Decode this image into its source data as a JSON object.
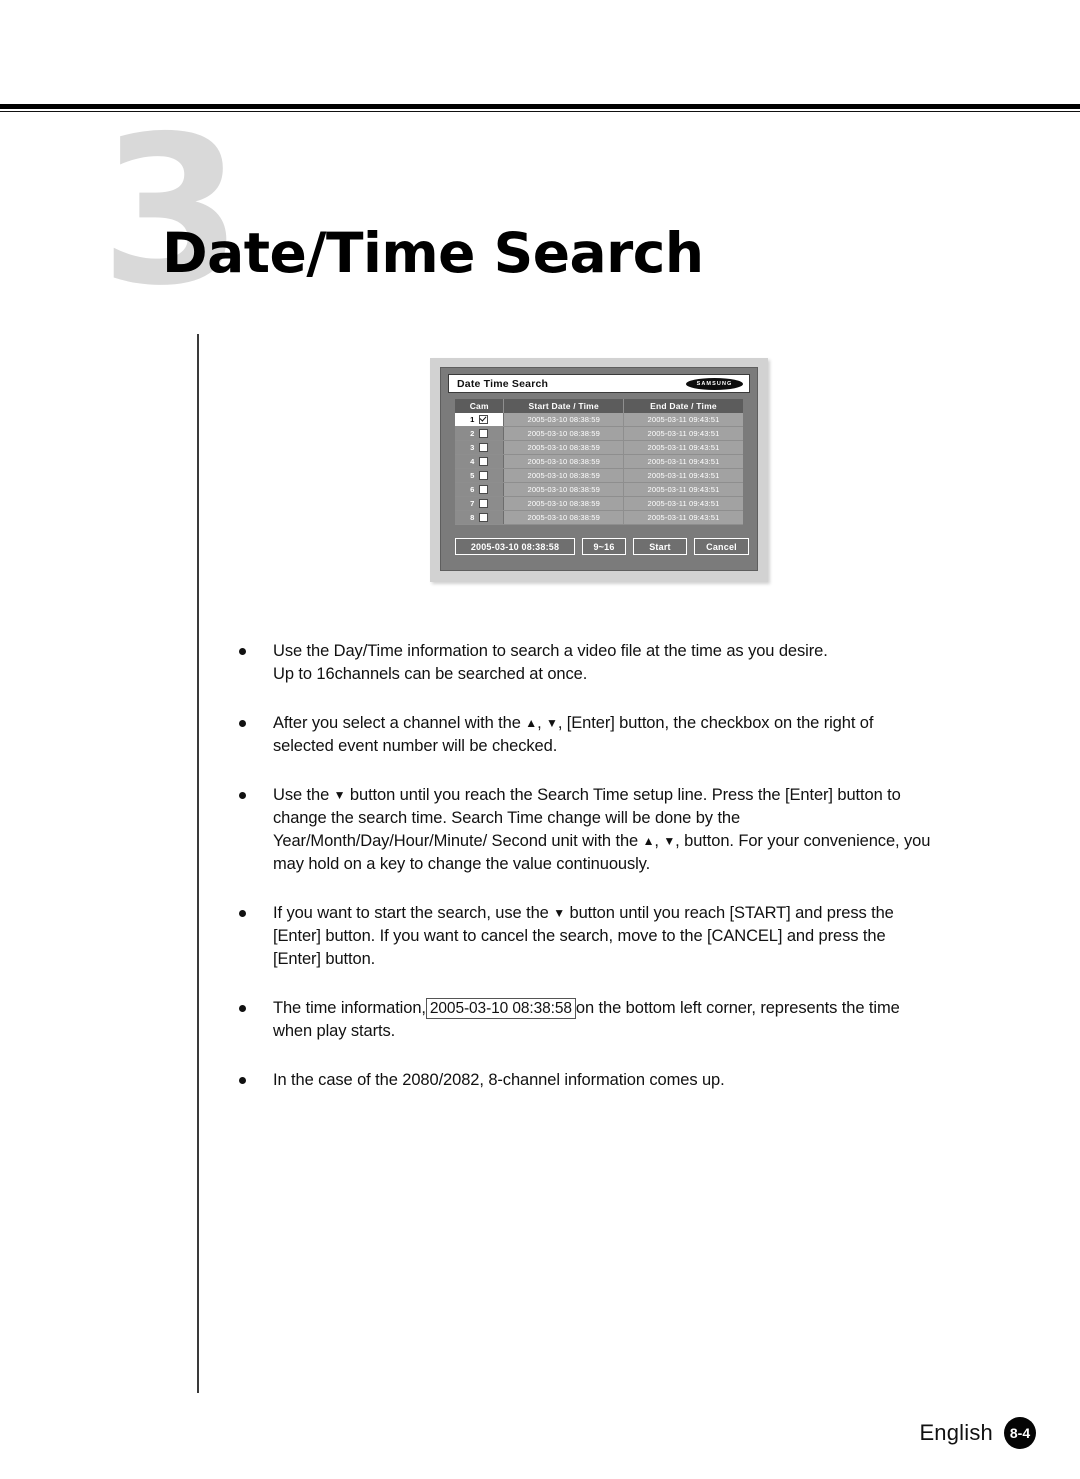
{
  "page": {
    "chapter_number": "3",
    "chapter_title": "Date/Time Search"
  },
  "dvr": {
    "window_title": "Date Time Search",
    "brand_logo": "SAMSUNG",
    "columns": {
      "cam": "Cam",
      "start": "Start Date / Time",
      "end": "End Date / Time"
    },
    "rows": [
      {
        "cam": "1",
        "checked": true,
        "start": "2005-03-10  08:38:59",
        "end": "2005-03-11  09:43:51"
      },
      {
        "cam": "2",
        "checked": false,
        "start": "2005-03-10  08:38:59",
        "end": "2005-03-11  09:43:51"
      },
      {
        "cam": "3",
        "checked": false,
        "start": "2005-03-10  08:38:59",
        "end": "2005-03-11  09:43:51"
      },
      {
        "cam": "4",
        "checked": false,
        "start": "2005-03-10  08:38:59",
        "end": "2005-03-11  09:43:51"
      },
      {
        "cam": "5",
        "checked": false,
        "start": "2005-03-10  08:38:59",
        "end": "2005-03-11  09:43:51"
      },
      {
        "cam": "6",
        "checked": false,
        "start": "2005-03-10  08:38:59",
        "end": "2005-03-11  09:43:51"
      },
      {
        "cam": "7",
        "checked": false,
        "start": "2005-03-10  08:38:59",
        "end": "2005-03-11  09:43:51"
      },
      {
        "cam": "8",
        "checked": false,
        "start": "2005-03-10  08:38:59",
        "end": "2005-03-11  09:43:51"
      }
    ],
    "buttons": {
      "search_time": "2005-03-10  08:38:58",
      "channel_range": "9~16",
      "start": "Start",
      "cancel": "Cancel"
    }
  },
  "bullets": {
    "b1_line1": "Use the Day/Time information to search a video file at the time as you desire.",
    "b1_line2": "Up to 16channels can be searched at once.",
    "b2_part1": "After you select a channel with the ",
    "b2_arrow_up": "▲",
    "b2_part2": ", ",
    "b2_arrow_down": "▼",
    "b2_part3": ", [Enter] button, the checkbox on the right of selected event number will be checked.",
    "b3_part1": "Use the ",
    "b3_arrow_down_1": "▼",
    "b3_part2": " button until you reach the Search Time setup line. Press the [Enter] button to change the search time. Search Time change will be done by the Year/Month/Day/Hour/Minute/ Second unit with the ",
    "b3_arrow_up": "▲",
    "b3_part3": ", ",
    "b3_arrow_down_2": "▼",
    "b3_part4": ", button. For your convenience, you may hold on a key to change the value continuously.",
    "b4_part1": "If you want to start the search, use the ",
    "b4_arrow_down": "▼",
    "b4_part2": " button until you reach [START] and press the [Enter] button. If you want to cancel the search, move to the [CANCEL] and press the [Enter] button.",
    "b5_part1": "The time information,",
    "b5_boxed": "2005-03-10 08:38:58",
    "b5_part2": "on the bottom left corner, represents the time when play starts.",
    "b6": "In the case of the 2080/2082, 8-channel information comes up."
  },
  "footer": {
    "language": "English",
    "page_number": "8-4"
  }
}
